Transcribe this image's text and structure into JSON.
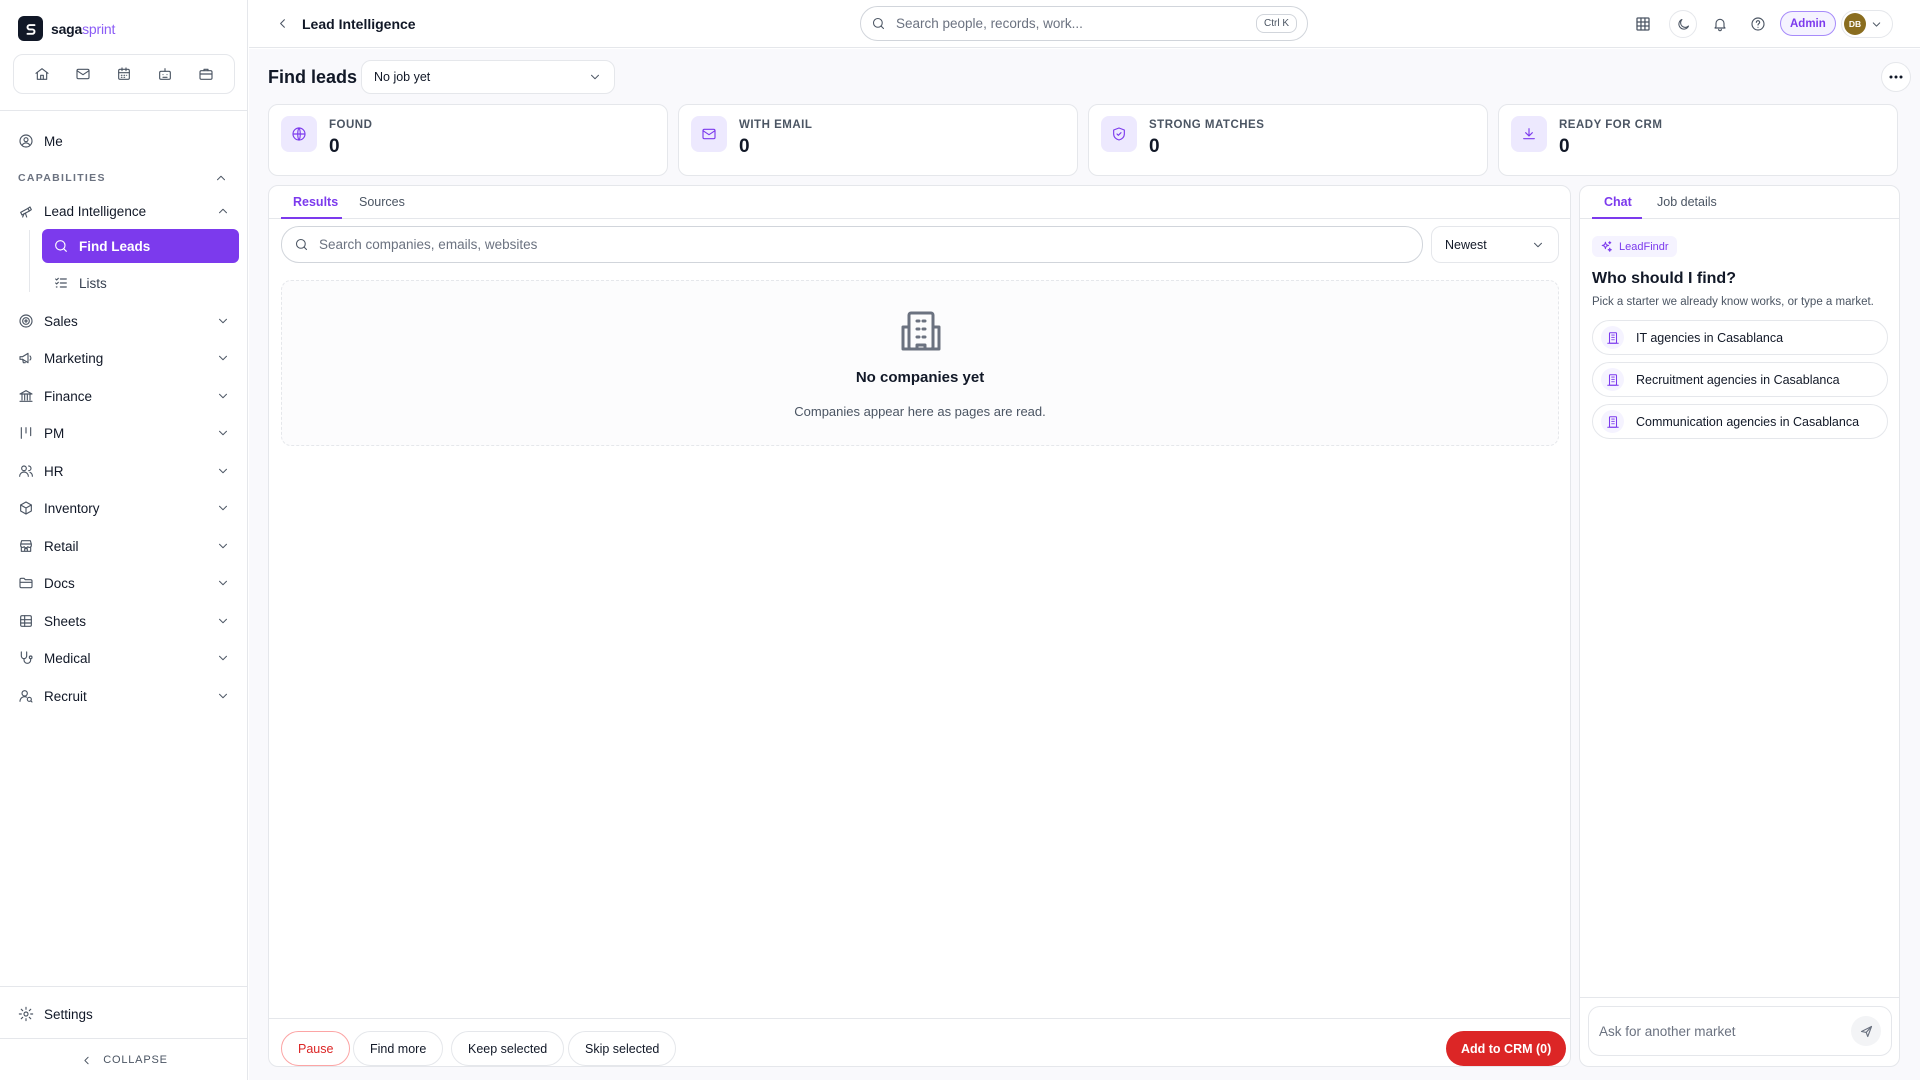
{
  "brand": {
    "name_bold": "saga",
    "name_light": "sprint"
  },
  "sidebar": {
    "quick_icons": [
      "home-icon",
      "mail-icon",
      "calendar-icon",
      "robot-icon",
      "briefcase-icon"
    ],
    "me_label": "Me",
    "capabilities_label": "CAPABILITIES",
    "lead_intelligence_label": "Lead Intelligence",
    "sub_items": [
      {
        "label": "Find Leads",
        "icon": "search-icon"
      },
      {
        "label": "Lists",
        "icon": "list-check-icon"
      }
    ],
    "items": [
      {
        "label": "Sales",
        "icon": "target-icon"
      },
      {
        "label": "Marketing",
        "icon": "megaphone-icon"
      },
      {
        "label": "Finance",
        "icon": "bank-icon"
      },
      {
        "label": "PM",
        "icon": "kanban-icon"
      },
      {
        "label": "HR",
        "icon": "users-icon"
      },
      {
        "label": "Inventory",
        "icon": "box-icon"
      },
      {
        "label": "Retail",
        "icon": "store-icon"
      },
      {
        "label": "Docs",
        "icon": "folder-icon"
      },
      {
        "label": "Sheets",
        "icon": "table-icon"
      },
      {
        "label": "Medical",
        "icon": "stethoscope-icon"
      },
      {
        "label": "Recruit",
        "icon": "user-search-icon"
      }
    ],
    "settings_label": "Settings",
    "collapse_label": "COLLAPSE"
  },
  "topbar": {
    "title": "Lead Intelligence",
    "search_placeholder": "Search people, records, work...",
    "search_shortcut": "Ctrl K",
    "admin_label": "Admin",
    "avatar_initials": "DB"
  },
  "page": {
    "heading": "Find leads",
    "job_select_value": "No job yet"
  },
  "stats": [
    {
      "label": "FOUND",
      "value": "0",
      "icon": "globe-icon"
    },
    {
      "label": "WITH EMAIL",
      "value": "0",
      "icon": "mail-icon"
    },
    {
      "label": "STRONG MATCHES",
      "value": "0",
      "icon": "shield-check-icon"
    },
    {
      "label": "READY FOR CRM",
      "value": "0",
      "icon": "download-icon"
    }
  ],
  "results": {
    "tabs": [
      "Results",
      "Sources"
    ],
    "search_placeholder": "Search companies, emails, websites",
    "sort_value": "Newest",
    "empty_title": "No companies yet",
    "empty_subtitle": "Companies appear here as pages are read.",
    "footer_buttons": [
      "Pause",
      "Find more",
      "Keep selected",
      "Skip selected"
    ],
    "crm_button": "Add to CRM (0)"
  },
  "chat": {
    "tabs": [
      "Chat",
      "Job details"
    ],
    "badge": "LeadFindr",
    "heading": "Who should I find?",
    "subtitle": "Pick a starter we already know works, or type a market.",
    "starters": [
      "IT agencies in Casablanca",
      "Recruitment agencies in Casablanca",
      "Communication agencies in Casablanca"
    ],
    "input_placeholder": "Ask for another market"
  },
  "colors": {
    "accent": "#7c3aed",
    "danger": "#dc2626",
    "accent_soft": "#ede9fe"
  }
}
